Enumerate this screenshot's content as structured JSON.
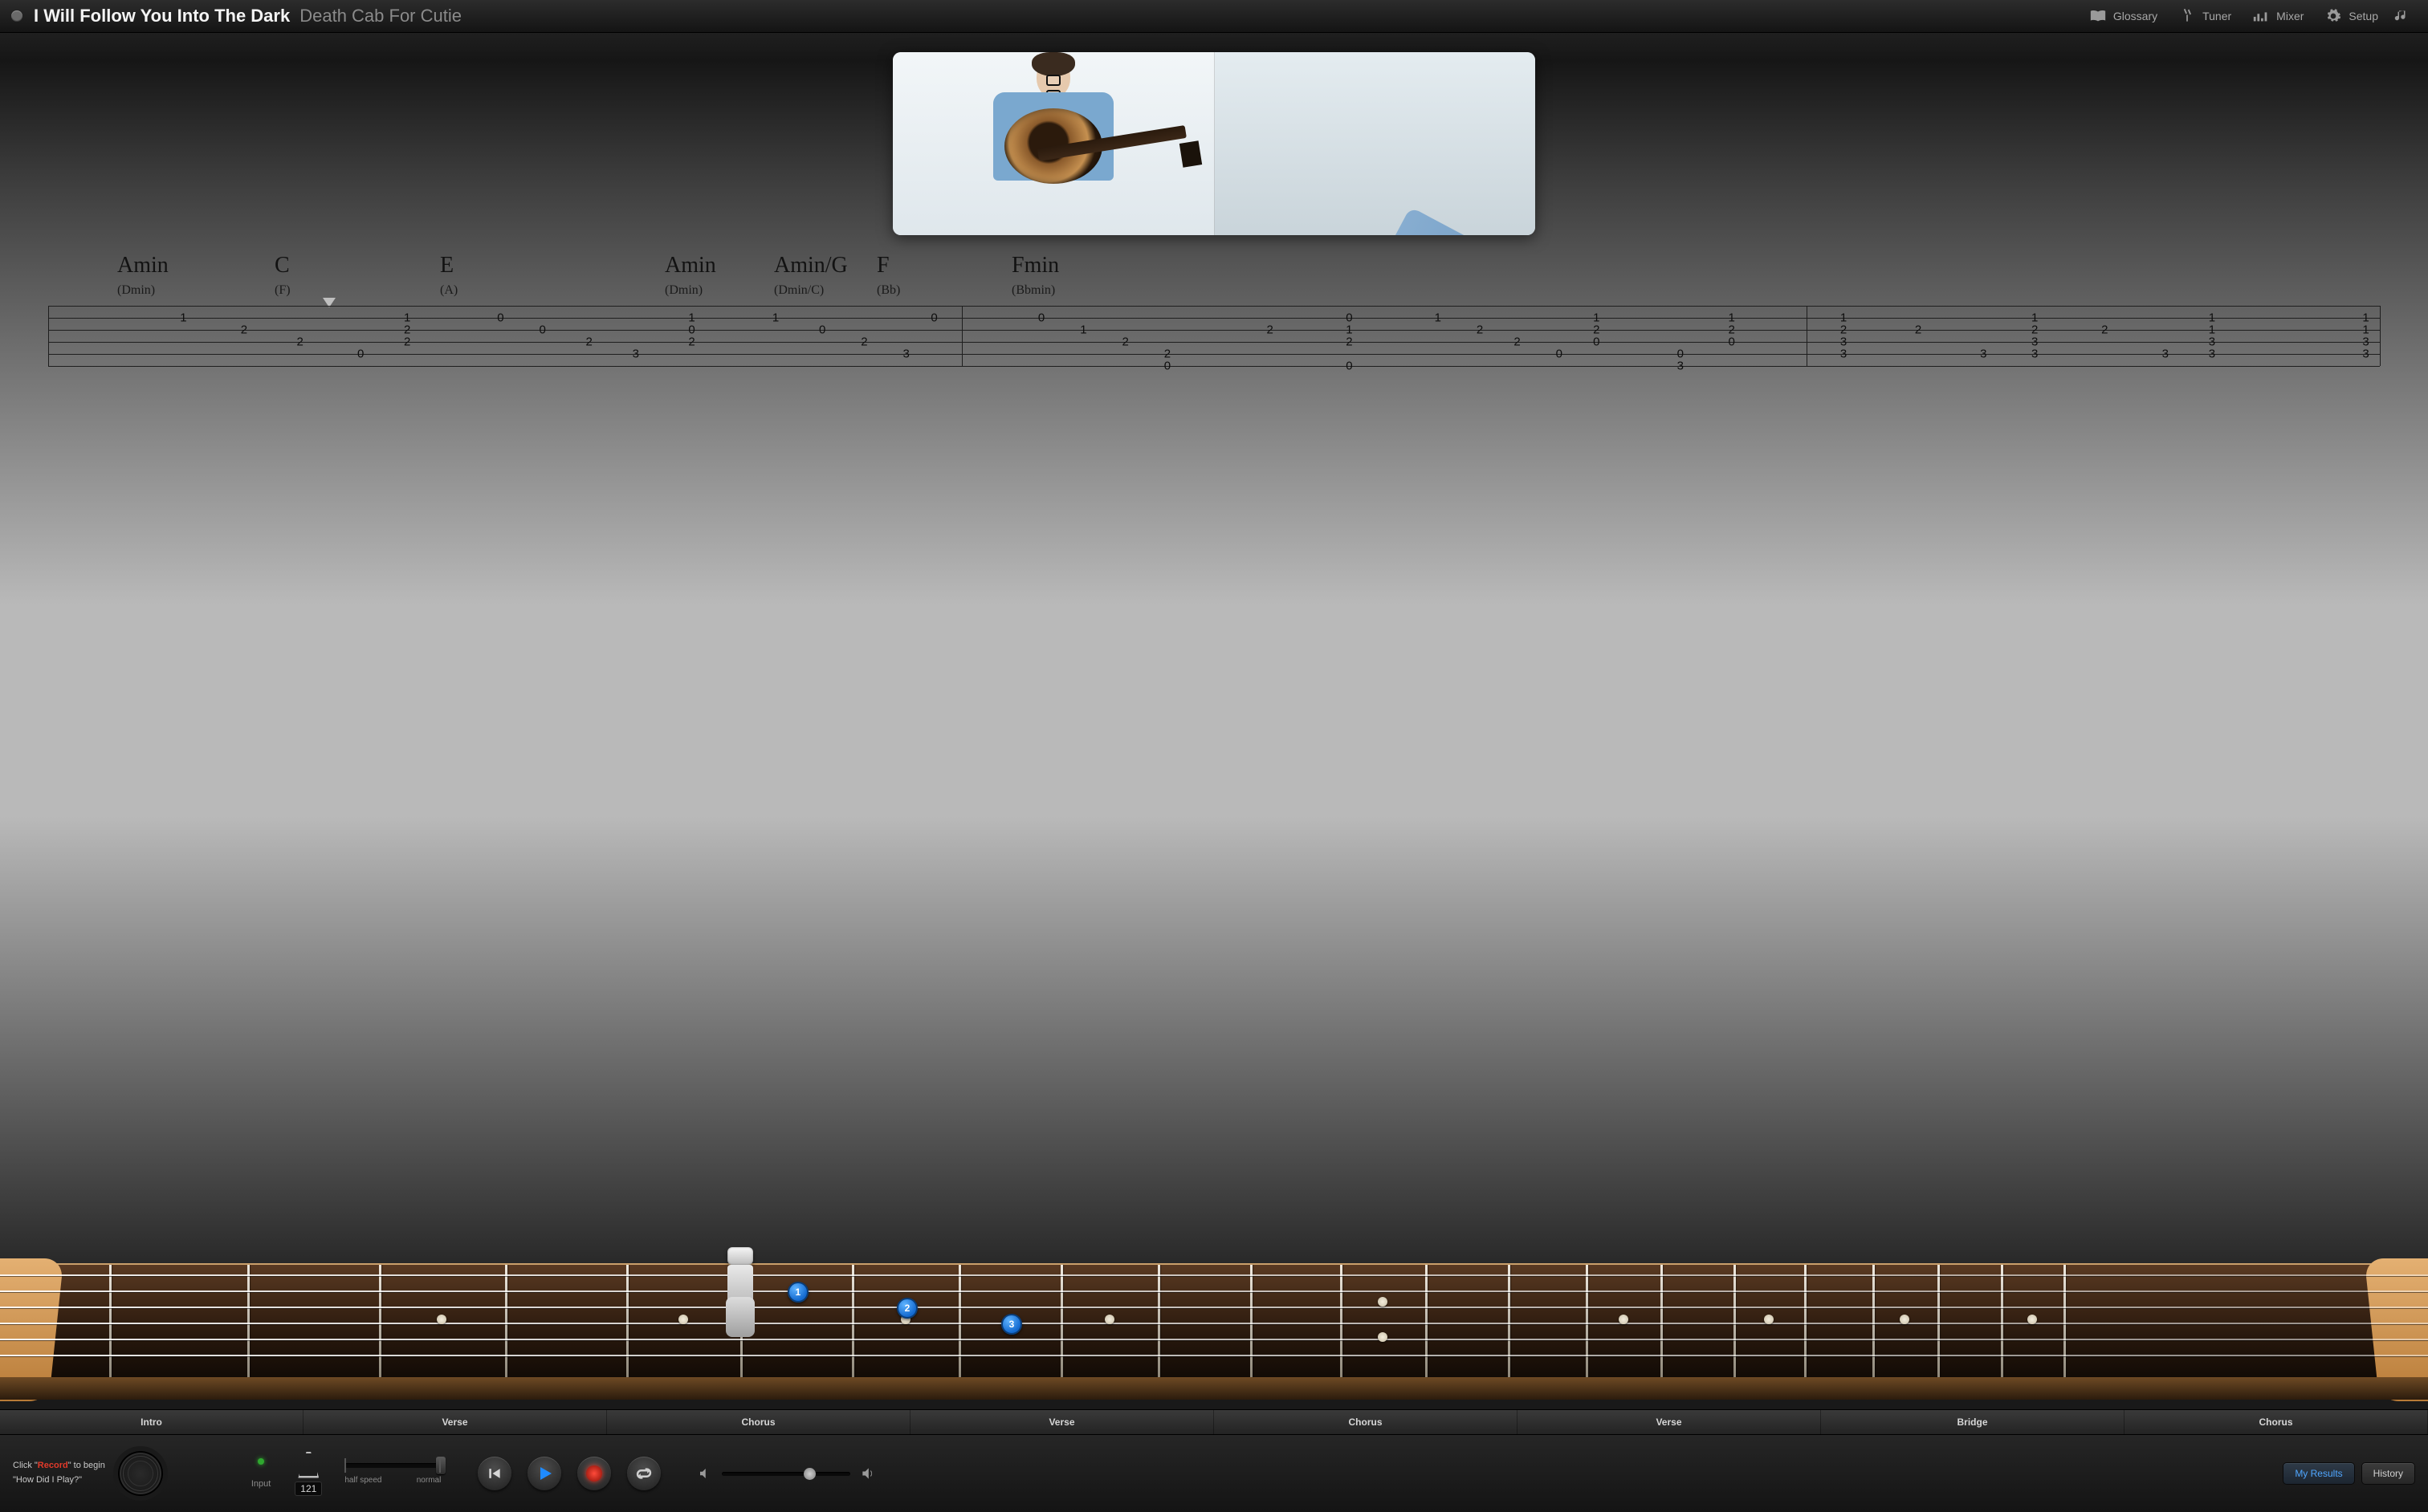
{
  "header": {
    "song_title": "I Will Follow You Into The Dark",
    "artist": "Death Cab For Cutie",
    "buttons": {
      "glossary": "Glossary",
      "tuner": "Tuner",
      "mixer": "Mixer",
      "setup": "Setup"
    }
  },
  "chords": [
    {
      "name": "Amin",
      "alt": "(Dmin)"
    },
    {
      "name": "C",
      "alt": "(F)"
    },
    {
      "name": "E",
      "alt": "(A)"
    },
    {
      "name": "Amin",
      "alt": "(Dmin)"
    },
    {
      "name": "Amin/G",
      "alt": "(Dmin/C)"
    },
    {
      "name": "F",
      "alt": "(Bb)"
    },
    {
      "name": "Fmin",
      "alt": "(Bbmin)"
    }
  ],
  "tab": {
    "strings": 6,
    "barlines_pct": [
      0,
      39.2,
      75.4,
      100
    ],
    "notes": [
      {
        "s": 2,
        "x": 5.8,
        "f": "1"
      },
      {
        "s": 3,
        "x": 8.4,
        "f": "2"
      },
      {
        "s": 4,
        "x": 10.8,
        "f": "2"
      },
      {
        "s": 5,
        "x": 13.4,
        "f": "0"
      },
      {
        "s": 2,
        "x": 15.4,
        "f": "1"
      },
      {
        "s": 3,
        "x": 15.4,
        "f": "2"
      },
      {
        "s": 4,
        "x": 15.4,
        "f": "2"
      },
      {
        "s": 2,
        "x": 19.4,
        "f": "0"
      },
      {
        "s": 3,
        "x": 21.2,
        "f": "0"
      },
      {
        "s": 4,
        "x": 23.2,
        "f": "2"
      },
      {
        "s": 5,
        "x": 25.2,
        "f": "3"
      },
      {
        "s": 2,
        "x": 27.6,
        "f": "1"
      },
      {
        "s": 3,
        "x": 27.6,
        "f": "0"
      },
      {
        "s": 4,
        "x": 27.6,
        "f": "2"
      },
      {
        "s": 2,
        "x": 31.2,
        "f": "1"
      },
      {
        "s": 3,
        "x": 33.2,
        "f": "0"
      },
      {
        "s": 4,
        "x": 35.0,
        "f": "2"
      },
      {
        "s": 5,
        "x": 36.8,
        "f": "3"
      },
      {
        "s": 2,
        "x": 38.0,
        "f": "0"
      },
      {
        "s": 2,
        "x": 42.6,
        "f": "0"
      },
      {
        "s": 3,
        "x": 44.4,
        "f": "1"
      },
      {
        "s": 4,
        "x": 46.2,
        "f": "2"
      },
      {
        "s": 5,
        "x": 48.0,
        "f": "2"
      },
      {
        "s": 6,
        "x": 48.0,
        "f": "0"
      },
      {
        "s": 3,
        "x": 52.4,
        "f": "2"
      },
      {
        "s": 2,
        "x": 55.8,
        "f": "0"
      },
      {
        "s": 3,
        "x": 55.8,
        "f": "1"
      },
      {
        "s": 4,
        "x": 55.8,
        "f": "2"
      },
      {
        "s": 6,
        "x": 55.8,
        "f": "0"
      },
      {
        "s": 2,
        "x": 59.6,
        "f": "1"
      },
      {
        "s": 3,
        "x": 61.4,
        "f": "2"
      },
      {
        "s": 4,
        "x": 63.0,
        "f": "2"
      },
      {
        "s": 5,
        "x": 64.8,
        "f": "0"
      },
      {
        "s": 2,
        "x": 66.4,
        "f": "1"
      },
      {
        "s": 3,
        "x": 66.4,
        "f": "2"
      },
      {
        "s": 4,
        "x": 66.4,
        "f": "0"
      },
      {
        "s": 5,
        "x": 70.0,
        "f": "0"
      },
      {
        "s": 6,
        "x": 70.0,
        "f": "3"
      },
      {
        "s": 2,
        "x": 72.2,
        "f": "1"
      },
      {
        "s": 3,
        "x": 72.2,
        "f": "2"
      },
      {
        "s": 4,
        "x": 72.2,
        "f": "0"
      },
      {
        "s": 2,
        "x": 77.0,
        "f": "1"
      },
      {
        "s": 3,
        "x": 77.0,
        "f": "2"
      },
      {
        "s": 4,
        "x": 77.0,
        "f": "3"
      },
      {
        "s": 5,
        "x": 77.0,
        "f": "3"
      },
      {
        "s": 3,
        "x": 80.2,
        "f": "2"
      },
      {
        "s": 5,
        "x": 83.0,
        "f": "3"
      },
      {
        "s": 2,
        "x": 85.2,
        "f": "1"
      },
      {
        "s": 3,
        "x": 85.2,
        "f": "2"
      },
      {
        "s": 4,
        "x": 85.2,
        "f": "3"
      },
      {
        "s": 5,
        "x": 85.2,
        "f": "3"
      },
      {
        "s": 3,
        "x": 88.2,
        "f": "2"
      },
      {
        "s": 5,
        "x": 90.8,
        "f": "3"
      },
      {
        "s": 2,
        "x": 92.8,
        "f": "1"
      },
      {
        "s": 3,
        "x": 92.8,
        "f": "1"
      },
      {
        "s": 4,
        "x": 92.8,
        "f": "3"
      },
      {
        "s": 5,
        "x": 92.8,
        "f": "3"
      },
      {
        "s": 2,
        "x": 99.4,
        "f": "1"
      },
      {
        "s": 3,
        "x": 99.4,
        "f": "1"
      },
      {
        "s": 4,
        "x": 99.4,
        "f": "3"
      },
      {
        "s": 5,
        "x": 99.4,
        "f": "3"
      }
    ]
  },
  "fretboard": {
    "capo_fret": 5,
    "total_frets": 21,
    "fret_edges_pct": [
      4.5,
      10.2,
      15.6,
      20.8,
      25.8,
      30.5,
      35.1,
      39.5,
      43.7,
      47.7,
      51.5,
      55.2,
      58.7,
      62.1,
      65.3,
      68.4,
      71.4,
      74.3,
      77.1,
      79.8,
      82.4,
      85.0
    ],
    "inlay_single_frets": [
      3,
      5,
      7,
      9,
      15,
      17,
      19,
      21
    ],
    "inlay_double_frets": [
      12
    ],
    "fingers": [
      {
        "label": "1",
        "string": 2,
        "rel_fret": 1
      },
      {
        "label": "2",
        "string": 3,
        "rel_fret": 2
      },
      {
        "label": "3",
        "string": 4,
        "rel_fret": 3
      }
    ]
  },
  "sections": {
    "items": [
      "Intro",
      "Verse",
      "Chorus",
      "Verse",
      "Chorus",
      "Verse",
      "Bridge",
      "Chorus"
    ],
    "active_index": 2
  },
  "transport": {
    "hint_pre": "Click \"",
    "hint_hot": "Record",
    "hint_post": "\" to begin",
    "hint_line2": "\"How Did I Play?\"",
    "input_label": "Input",
    "bpm": "121",
    "speed_half": "half speed",
    "speed_normal": "normal",
    "speed_value_pct": 100,
    "volume_pct": 68,
    "my_results": "My Results",
    "history": "History"
  }
}
